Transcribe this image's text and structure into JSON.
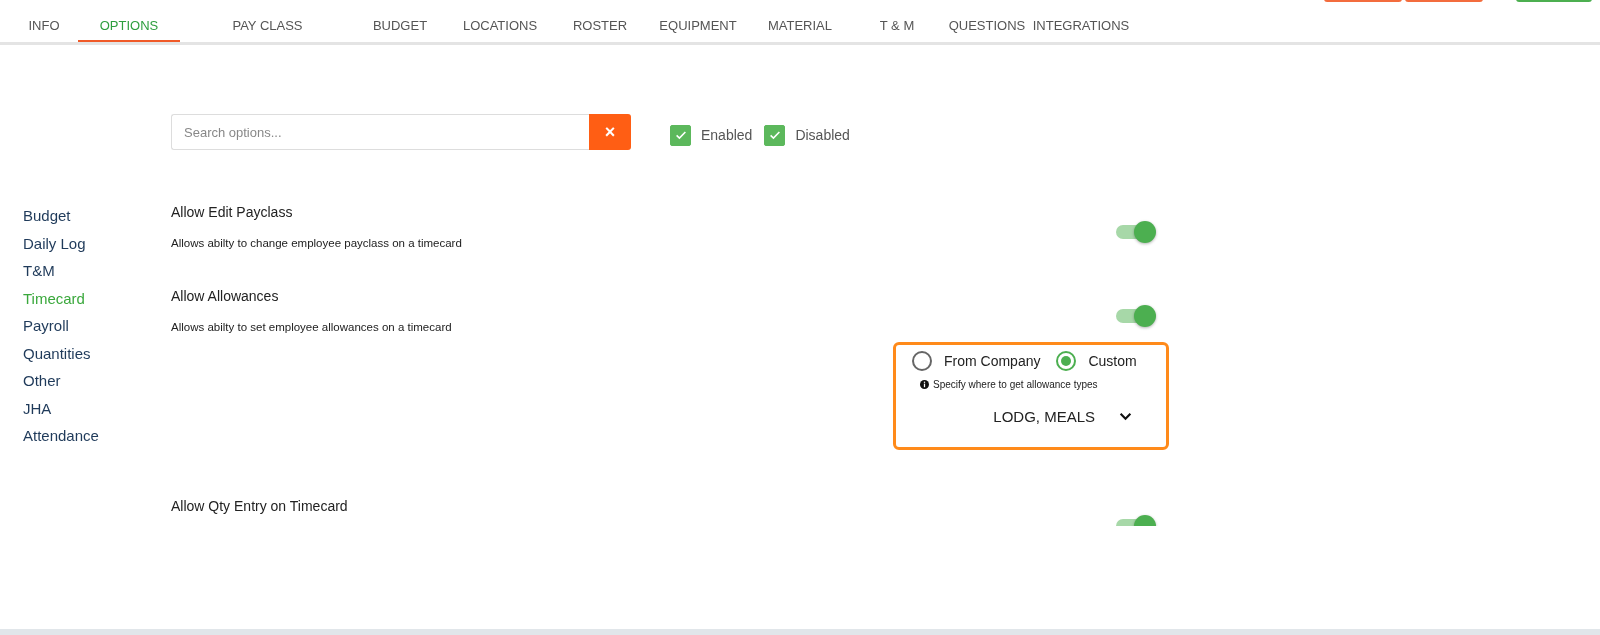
{
  "tabs": [
    {
      "label": "INFO",
      "selected": false
    },
    {
      "label": "OPTIONS",
      "selected": true
    },
    {
      "label": "PAY CLASS",
      "selected": false
    },
    {
      "label": "BUDGET",
      "selected": false
    },
    {
      "label": "LOCATIONS",
      "selected": false
    },
    {
      "label": "ROSTER",
      "selected": false
    },
    {
      "label": "EQUIPMENT",
      "selected": false
    },
    {
      "label": "MATERIAL",
      "selected": false
    },
    {
      "label": "T & M",
      "selected": false
    },
    {
      "label": "QUESTIONS",
      "selected": false
    },
    {
      "label": "INTEGRATIONS",
      "selected": false
    }
  ],
  "search": {
    "placeholder": "Search options...",
    "clear_icon": "×"
  },
  "filters": [
    {
      "label": "Enabled",
      "checked": true
    },
    {
      "label": "Disabled",
      "checked": true
    }
  ],
  "sidebar": {
    "items": [
      {
        "label": "Budget",
        "selected": false
      },
      {
        "label": "Daily Log",
        "selected": false
      },
      {
        "label": "T&M",
        "selected": false
      },
      {
        "label": "Timecard",
        "selected": true
      },
      {
        "label": "Payroll",
        "selected": false
      },
      {
        "label": "Quantities",
        "selected": false
      },
      {
        "label": "Other",
        "selected": false
      },
      {
        "label": "JHA",
        "selected": false
      },
      {
        "label": "Attendance",
        "selected": false
      }
    ]
  },
  "options": [
    {
      "title": "Allow Edit Payclass",
      "description": "Allows abilty to change employee payclass on a timecard",
      "on": true
    },
    {
      "title": "Allow Allowances",
      "description": "Allows abilty to set employee allowances on a timecard",
      "on": true,
      "source": {
        "choices": [
          {
            "label": "From Company",
            "selected": false
          },
          {
            "label": "Custom",
            "selected": true
          }
        ],
        "hint": "Specify where to get allowance types",
        "value": "LODG, MEALS"
      }
    },
    {
      "title": "Allow Qty Entry on Timecard",
      "on": true
    }
  ]
}
